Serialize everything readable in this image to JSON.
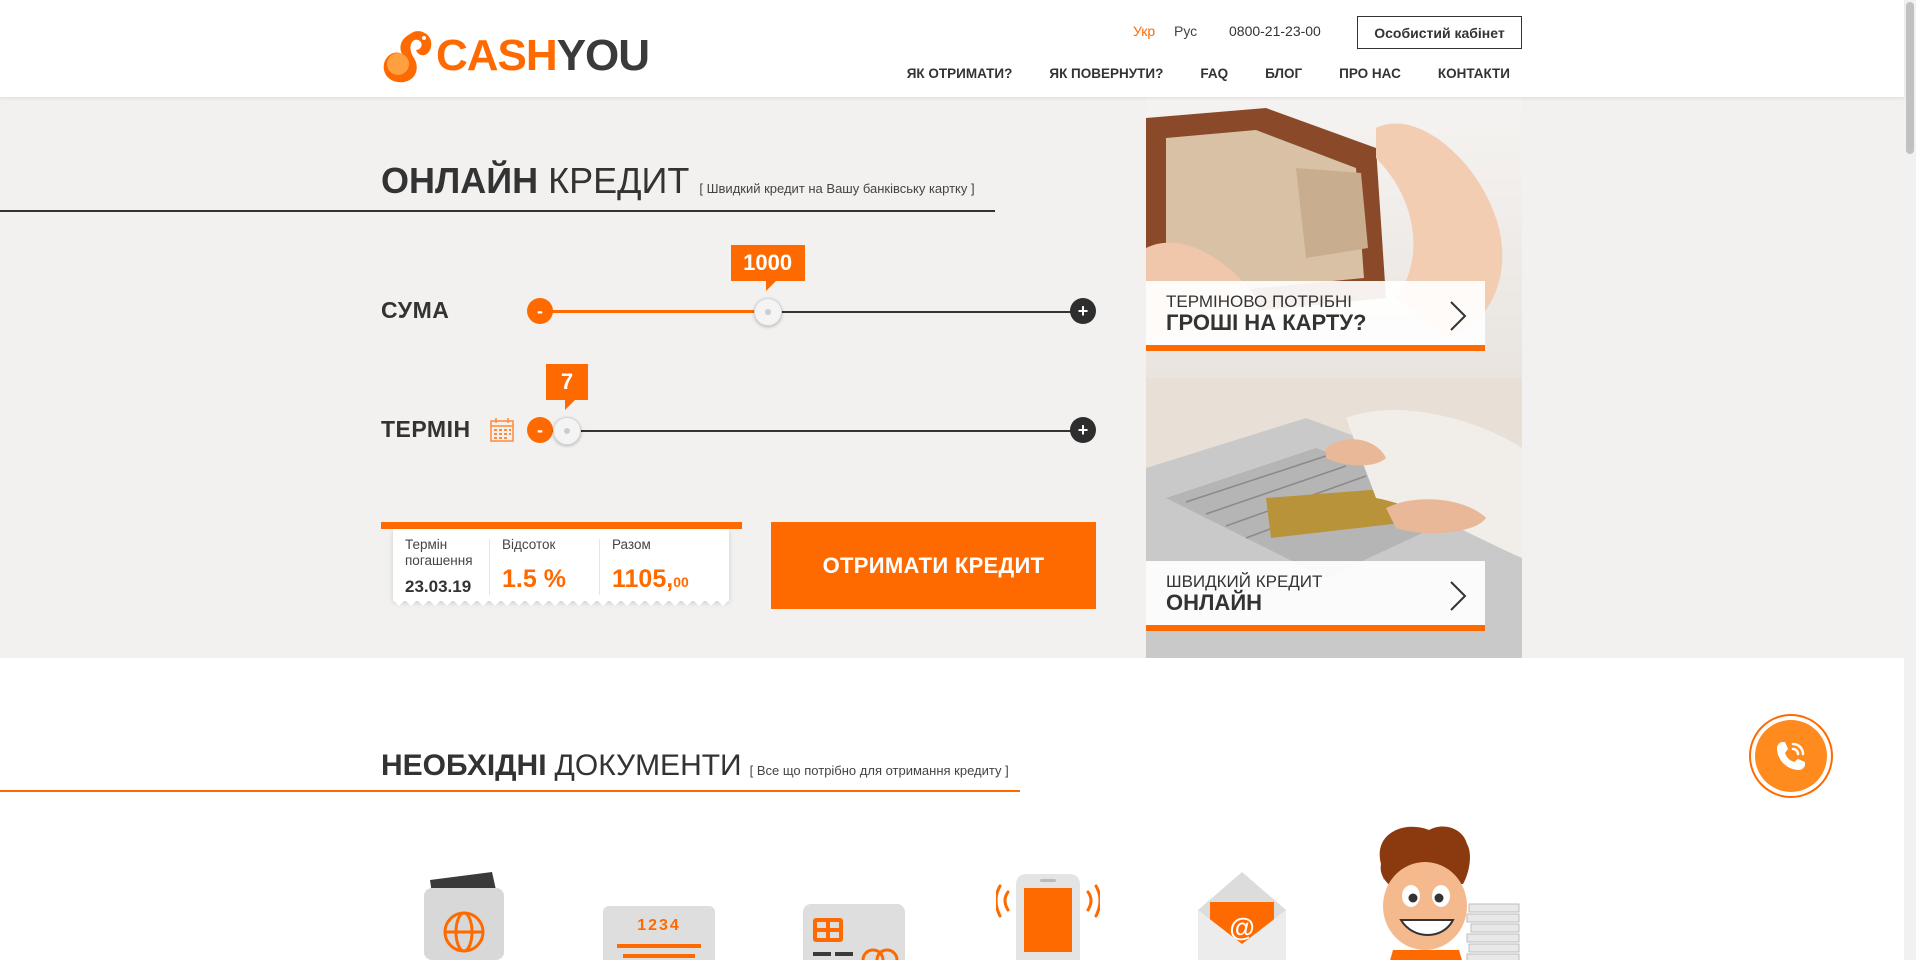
{
  "brand": {
    "cash": "CASH",
    "you": "YOU"
  },
  "header": {
    "lang_ukr": "Укр",
    "lang_rus": "Рус",
    "phone": "0800-21-23-00",
    "cabinet": "Особистий кабінет",
    "nav": [
      "ЯК ОТРИМАТИ?",
      "ЯК ПОВЕРНУТИ?",
      "FAQ",
      "БЛОГ",
      "ПРО НАС",
      "КОНТАКТИ"
    ]
  },
  "hero": {
    "title_bold": "ОНЛАЙН",
    "title_light": "КРЕДИТ",
    "title_sub": "[ Швидкий кредит на Вашу банківську картку ]",
    "amount": {
      "label": "СУМА",
      "value": "1000",
      "minus": "-",
      "plus": "+",
      "fraction": 0.42
    },
    "term": {
      "label": "ТЕРМІН",
      "value": "7",
      "minus": "-",
      "plus": "+",
      "fraction": 0.0
    },
    "summary": {
      "due_label": "Термін погашення",
      "due_value": "23.03.19",
      "rate_label": "Відсоток",
      "rate_value": "1.5 %",
      "total_label": "Разом",
      "total_int": "1105,",
      "total_dec": "00"
    },
    "cta": "ОТРИМАТИ КРЕДИТ"
  },
  "promos": [
    {
      "line1": "ТЕРМІНОВО ПОТРІБНІ",
      "line2": "ГРОШІ НА КАРТУ?"
    },
    {
      "line1": "ШВИДКИЙ КРЕДИТ",
      "line2": "ОНЛАЙН"
    }
  ],
  "docs": {
    "title_bold": "НЕОБХІДНІ",
    "title_light": "ДОКУМЕНТИ",
    "title_sub": "[ Все що потрібно для отримання кредиту ]",
    "card_number": "1234",
    "email_symbol": "@"
  },
  "icons": [
    "squirrel-logo-icon",
    "calendar-icon",
    "chevron-right-icon",
    "passport-icon",
    "card-number-icon",
    "id-card-icon",
    "phone-icon",
    "email-icon",
    "mascot-icon",
    "phone-call-icon"
  ],
  "colors": {
    "accent": "#ff6a00",
    "dark": "#333333",
    "hero_bg": "#f2f1ef"
  }
}
